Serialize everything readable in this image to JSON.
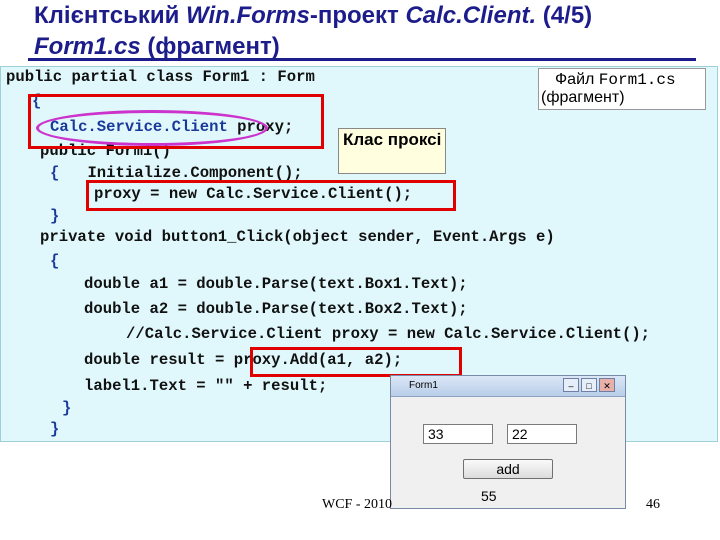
{
  "slide": {
    "title_part1": "Клієнтський ",
    "title_part2": "Win.Forms",
    "title_part3": "-проект ",
    "title_part4": "Calc.Client.",
    "title_part5": " (4/5)",
    "subtitle_part1": "Form1.cs",
    "subtitle_part2": " (фрагмент)"
  },
  "code": {
    "line1": "public partial class Form1 : Form",
    "line2": "{",
    "line3_a": "Calc.Service.Client",
    "line3_b": " proxy;",
    "line4": "public Form1()",
    "line5_a": "{   ",
    "line5_b": "Initialize.Component();",
    "line6": "proxy = new Calc.Service.Client();",
    "line7": "}",
    "line8": "private void button1_Click(object sender, Event.Args e)",
    "line9": "{",
    "line10": "double a1 = double.Parse(text.Box1.Text);",
    "line11": "double a2 = double.Parse(text.Box2.Text);",
    "line12": "//Calc.Service.Client proxy = new Calc.Service.Client();",
    "line13_a": "double result = ",
    "line13_b": "proxy.Add(a1, a2);",
    "line14": "label1.Text = \"\" + result;",
    "line15": "}",
    "line16": "}"
  },
  "annotations": {
    "proxy_class_label": "Клас проксі",
    "file_label_1": "Файл ",
    "file_label_2": "Form1.cs",
    "file_label_3": "(фрагмент)"
  },
  "form_window": {
    "title": "Form1",
    "textbox1": "33",
    "textbox2": "22",
    "add_button": "add",
    "result_label": "55",
    "min_glyph": "–",
    "max_glyph": "□",
    "close_glyph": "✕"
  },
  "footer": {
    "left": "WCF - 2010",
    "page": "46"
  },
  "colors": {
    "title": "#1c1c8a",
    "code_bg": "#e0f8fc",
    "highlight_red": "#e00000",
    "oval": "#cc33cc",
    "note_bg": "#ffffe0"
  }
}
